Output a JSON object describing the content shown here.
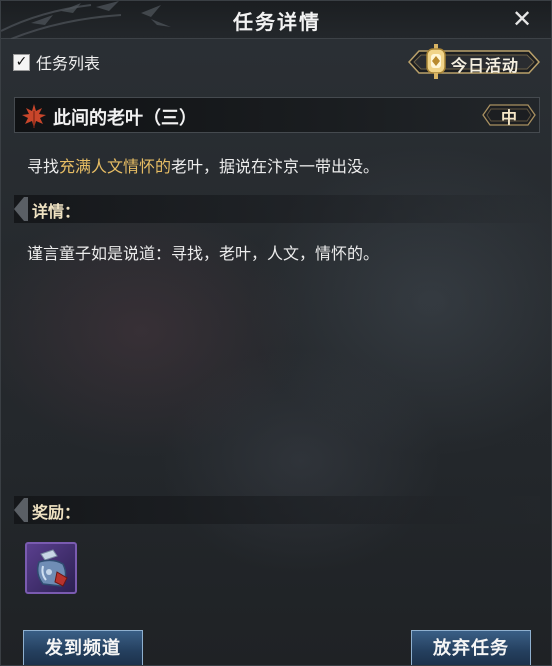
{
  "header": {
    "title": "任务详情"
  },
  "task_list": {
    "label": "任务列表",
    "checked": true
  },
  "today_activity": {
    "label": "今日活动",
    "icon": "lantern-icon"
  },
  "quest": {
    "name": "此间的老叶（三）",
    "difficulty": "中",
    "objective_prefix": "寻找",
    "objective_highlight": "充满人文情怀的",
    "objective_suffix": "老叶，据说在汴京一带出没。"
  },
  "details": {
    "header": "详情：",
    "text": "谨言童子如是说道：寻找，老叶，人文，情怀的。"
  },
  "reward": {
    "header": "奖励：",
    "item_icon": "potion-item-icon"
  },
  "buttons": {
    "share": "发到频道",
    "abandon": "放弃任务"
  },
  "colors": {
    "highlight": "#e7bd64",
    "section_label": "#efe2c2",
    "button_blue": "#2b4a6d"
  }
}
